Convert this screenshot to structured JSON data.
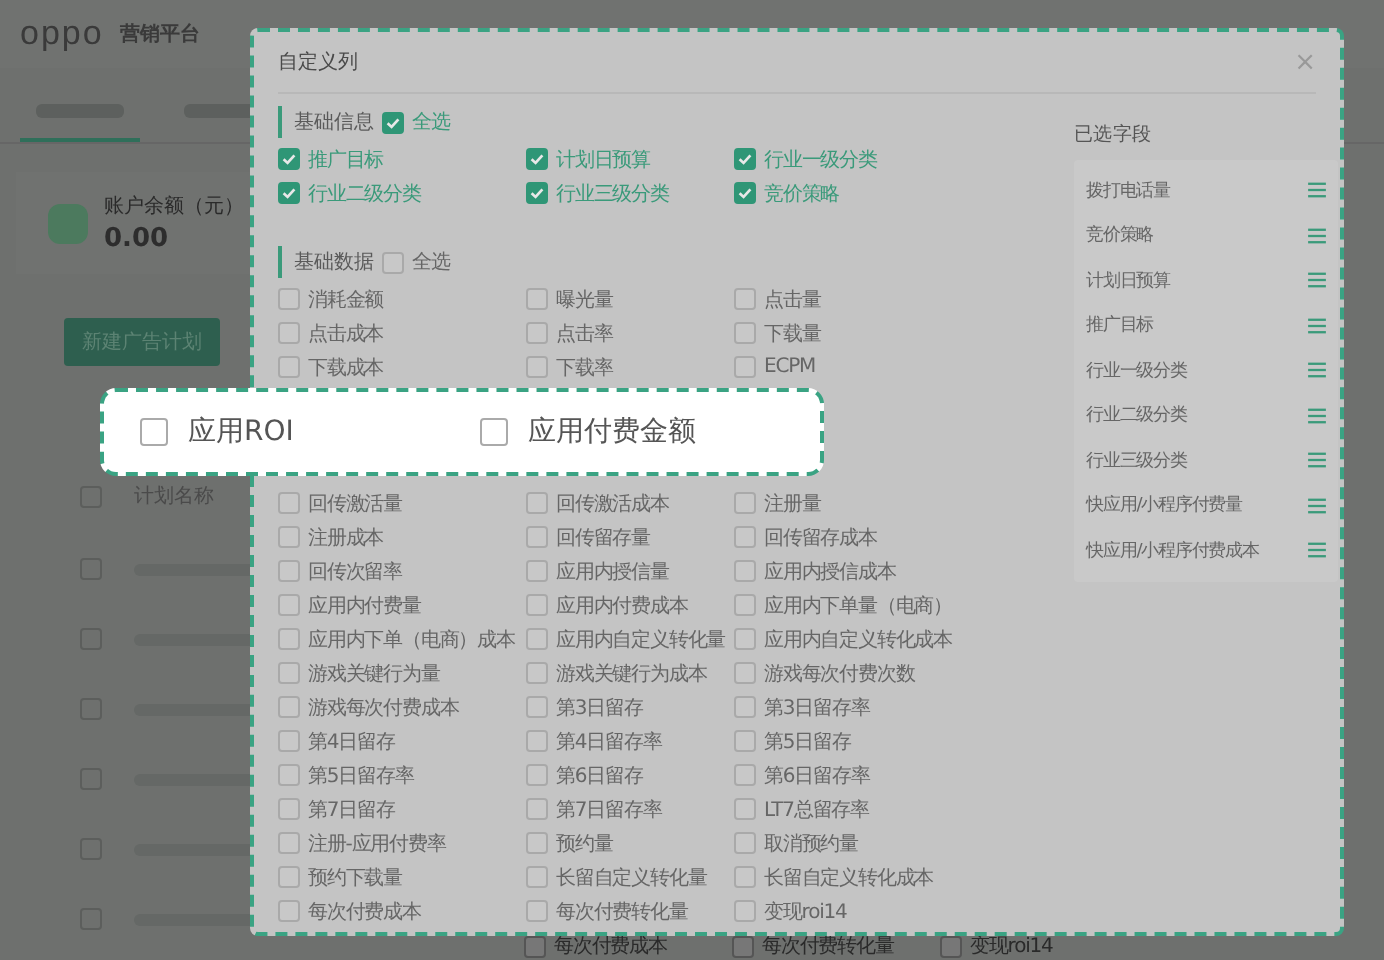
{
  "background": {
    "logo": "oppo",
    "product": "营销平台",
    "balance_label": "账户余额（元）",
    "balance": "0.00",
    "create_button": "新建广告计划",
    "column_header": "计划名称",
    "header_checkbox": {
      "checked": false
    },
    "table_rows": [
      {
        "checked": false
      },
      {
        "checked": false
      },
      {
        "checked": false
      },
      {
        "checked": false
      },
      {
        "checked": false
      },
      {
        "checked": false
      }
    ],
    "bottom_options": [
      {
        "label": "每次付费成本",
        "checked": false
      },
      {
        "label": "每次付费转化量",
        "checked": false
      },
      {
        "label": "变现roi14",
        "checked": false
      }
    ]
  },
  "dialog": {
    "title": "自定义列",
    "close": "×",
    "sections": [
      {
        "title": "基础信息",
        "select_all": {
          "label": "全选",
          "checked": true
        },
        "options": [
          {
            "label": "推广目标",
            "checked": true
          },
          {
            "label": "计划日预算",
            "checked": true
          },
          {
            "label": "行业一级分类",
            "checked": true
          },
          {
            "label": "行业二级分类",
            "checked": true
          },
          {
            "label": "行业三级分类",
            "checked": true
          },
          {
            "label": "竞价策略",
            "checked": true
          }
        ]
      },
      {
        "title": "基础数据",
        "select_all": {
          "label": "全选",
          "checked": false
        },
        "options": [
          {
            "label": "消耗金额",
            "checked": false
          },
          {
            "label": "曝光量",
            "checked": false
          },
          {
            "label": "点击量",
            "checked": false
          },
          {
            "label": "点击成本",
            "checked": false
          },
          {
            "label": "点击率",
            "checked": false
          },
          {
            "label": "下载量",
            "checked": false
          },
          {
            "label": "下载成本",
            "checked": false
          },
          {
            "label": "下载率",
            "checked": false
          },
          {
            "label": "ECPM",
            "checked": false
          }
        ],
        "magnified_options": [
          {
            "label": "应用ROI",
            "checked": false
          },
          {
            "label": "应用付费金额",
            "checked": false
          }
        ],
        "more_options": [
          {
            "label": "回传激活量",
            "checked": false
          },
          {
            "label": "回传激活成本",
            "checked": false
          },
          {
            "label": "注册量",
            "checked": false
          },
          {
            "label": "注册成本",
            "checked": false
          },
          {
            "label": "回传留存量",
            "checked": false
          },
          {
            "label": "回传留存成本",
            "checked": false
          },
          {
            "label": "回传次留率",
            "checked": false
          },
          {
            "label": "应用内授信量",
            "checked": false
          },
          {
            "label": "应用内授信成本",
            "checked": false
          },
          {
            "label": "应用内付费量",
            "checked": false
          },
          {
            "label": "应用内付费成本",
            "checked": false
          },
          {
            "label": "应用内下单量（电商）",
            "checked": false
          },
          {
            "label": "应用内下单（电商）成本",
            "checked": false
          },
          {
            "label": "应用内自定义转化量",
            "checked": false
          },
          {
            "label": "应用内自定义转化成本",
            "checked": false
          },
          {
            "label": "游戏关键行为量",
            "checked": false
          },
          {
            "label": "游戏关键行为成本",
            "checked": false
          },
          {
            "label": "游戏每次付费次数",
            "checked": false
          },
          {
            "label": "游戏每次付费成本",
            "checked": false
          },
          {
            "label": "第3日留存",
            "checked": false
          },
          {
            "label": "第3日留存率",
            "checked": false
          },
          {
            "label": "第4日留存",
            "checked": false
          },
          {
            "label": "第4日留存率",
            "checked": false
          },
          {
            "label": "第5日留存",
            "checked": false
          },
          {
            "label": "第5日留存率",
            "checked": false
          },
          {
            "label": "第6日留存",
            "checked": false
          },
          {
            "label": "第6日留存率",
            "checked": false
          },
          {
            "label": "第7日留存",
            "checked": false
          },
          {
            "label": "第7日留存率",
            "checked": false
          },
          {
            "label": "LT7总留存率",
            "checked": false
          },
          {
            "label": "注册-应用付费率",
            "checked": false
          },
          {
            "label": "预约量",
            "checked": false
          },
          {
            "label": "取消预约量",
            "checked": false
          },
          {
            "label": "预约下载量",
            "checked": false
          },
          {
            "label": "长留自定义转化量",
            "checked": false
          },
          {
            "label": "长留自定义转化成本",
            "checked": false
          },
          {
            "label": "每次付费成本",
            "checked": false
          },
          {
            "label": "每次付费转化量",
            "checked": false
          },
          {
            "label": "变现roi14",
            "checked": false
          }
        ]
      }
    ],
    "selected_fields": {
      "title": "已选字段",
      "items": [
        "拨打电话量",
        "竞价策略",
        "计划日预算",
        "推广目标",
        "行业一级分类",
        "行业二级分类",
        "行业三级分类",
        "快应用/小程序付费量",
        "快应用/小程序付费成本"
      ]
    }
  }
}
